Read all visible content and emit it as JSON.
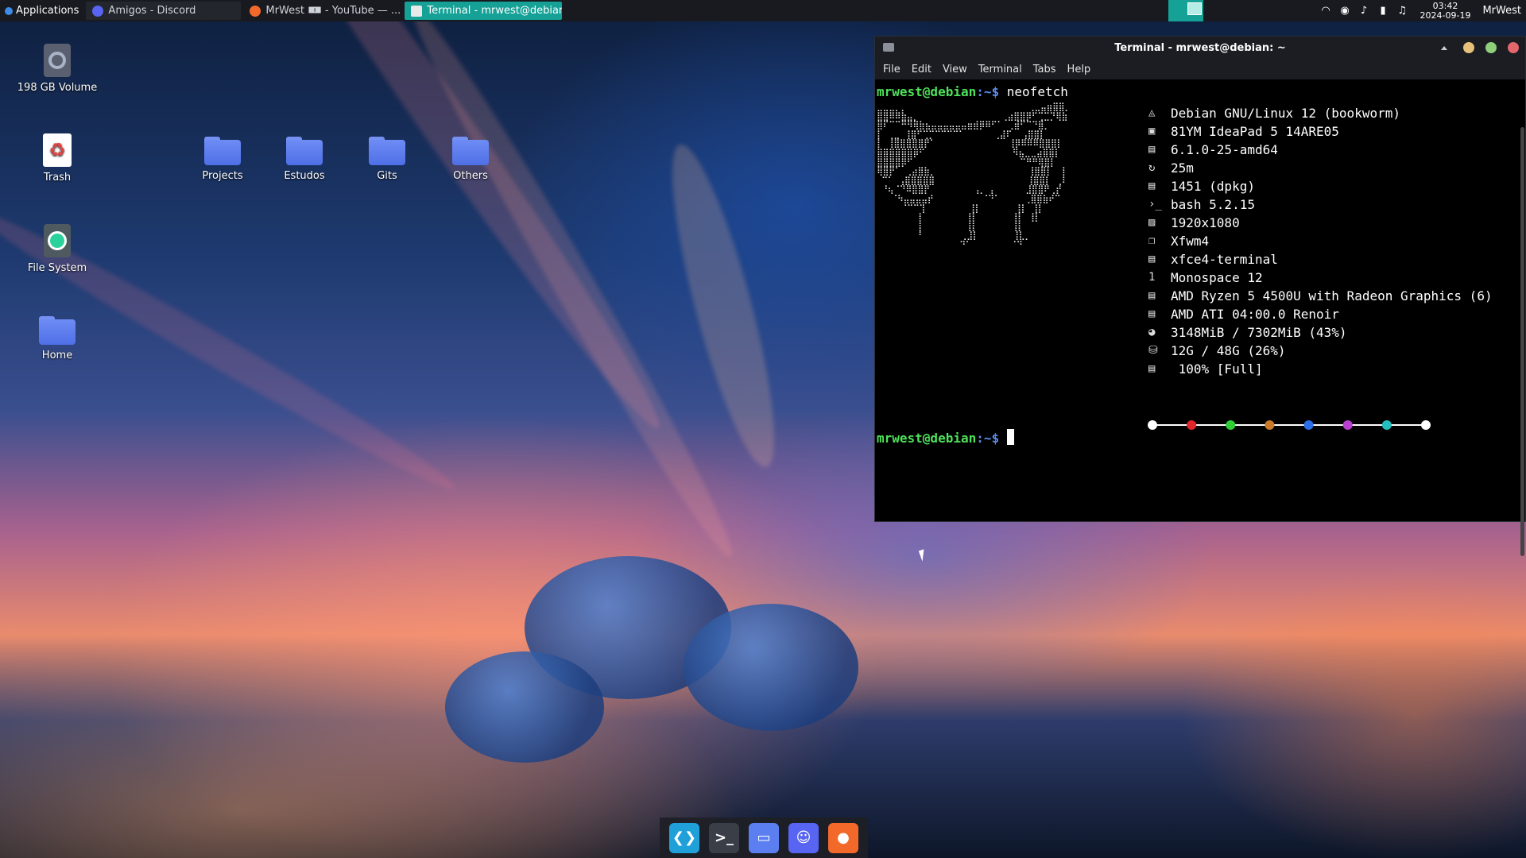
{
  "panel": {
    "apps_label": "Applications",
    "tasks": [
      {
        "label": "Amigos - Discord",
        "icon": "discord-icon",
        "state": "dim"
      },
      {
        "label": "MrWest 🀰 - YouTube — ...",
        "icon": "firefox-icon",
        "state": "normal"
      },
      {
        "label": "Terminal - mrwest@debian:...",
        "icon": "terminal-icon",
        "state": "active"
      }
    ],
    "time": "03:42",
    "date": "2024-09-19",
    "user": "MrWest",
    "accent": "#16a196"
  },
  "desktop": {
    "icons": [
      {
        "label": "198 GB Volume",
        "icon": "drive-icon"
      },
      {
        "label": "Trash",
        "icon": "trash-icon"
      },
      {
        "label": "File System",
        "icon": "filesystem-icon"
      },
      {
        "label": "Home",
        "icon": "home-folder-icon"
      },
      {
        "label": "Projects",
        "icon": "folder-icon"
      },
      {
        "label": "Estudos",
        "icon": "folder-icon"
      },
      {
        "label": "Gits",
        "icon": "folder-icon"
      },
      {
        "label": "Others",
        "icon": "folder-icon"
      }
    ]
  },
  "terminal": {
    "title": "Terminal - mrwest@debian: ~",
    "menu": [
      "File",
      "Edit",
      "View",
      "Terminal",
      "Tabs",
      "Help"
    ],
    "prompt_user": "mrwest@debian",
    "prompt_sep": ":~$",
    "command": "neofetch",
    "info": [
      {
        "icon": "os-icon",
        "value": "Debian GNU/Linux 12 (bookworm)"
      },
      {
        "icon": "host-icon",
        "value": "81YM IdeaPad 5 14ARE05"
      },
      {
        "icon": "kernel-icon",
        "value": "6.1.0-25-amd64"
      },
      {
        "icon": "uptime-icon",
        "value": "25m"
      },
      {
        "icon": "packages-icon",
        "value": "1451 (dpkg)"
      },
      {
        "icon": "shell-icon",
        "value": "bash 5.2.15"
      },
      {
        "icon": "resolution-icon",
        "value": "1920x1080"
      },
      {
        "icon": "wm-icon",
        "value": "Xfwm4"
      },
      {
        "icon": "terminal-app-icon",
        "value": "xfce4-terminal"
      },
      {
        "icon": "font-icon",
        "value": "Monospace 12"
      },
      {
        "icon": "cpu-icon",
        "value": "AMD Ryzen 5 4500U with Radeon Graphics (6)"
      },
      {
        "icon": "gpu-icon",
        "value": "AMD ATI 04:00.0 Renoir"
      },
      {
        "icon": "memory-icon",
        "value": "3148MiB / 7302MiB (43%)"
      },
      {
        "icon": "disk-icon",
        "value": "12G / 48G (26%)"
      },
      {
        "icon": "battery-icon",
        "value": " 100% [Full]"
      }
    ],
    "palette_colors": [
      "#ffffff",
      "#e0262b",
      "#2fce36",
      "#c87a28",
      "#2b6ee8",
      "#b83fd0",
      "#26bfbf",
      "#ffffff"
    ]
  },
  "dock": {
    "apps": [
      {
        "name": "vscode-icon",
        "color": "#1fa0d8"
      },
      {
        "name": "terminal-icon",
        "color": "#3a3e46"
      },
      {
        "name": "files-icon",
        "color": "#5b7ff0"
      },
      {
        "name": "discord-icon",
        "color": "#5865f2"
      },
      {
        "name": "firefox-icon",
        "color": "#f3692a"
      }
    ]
  }
}
